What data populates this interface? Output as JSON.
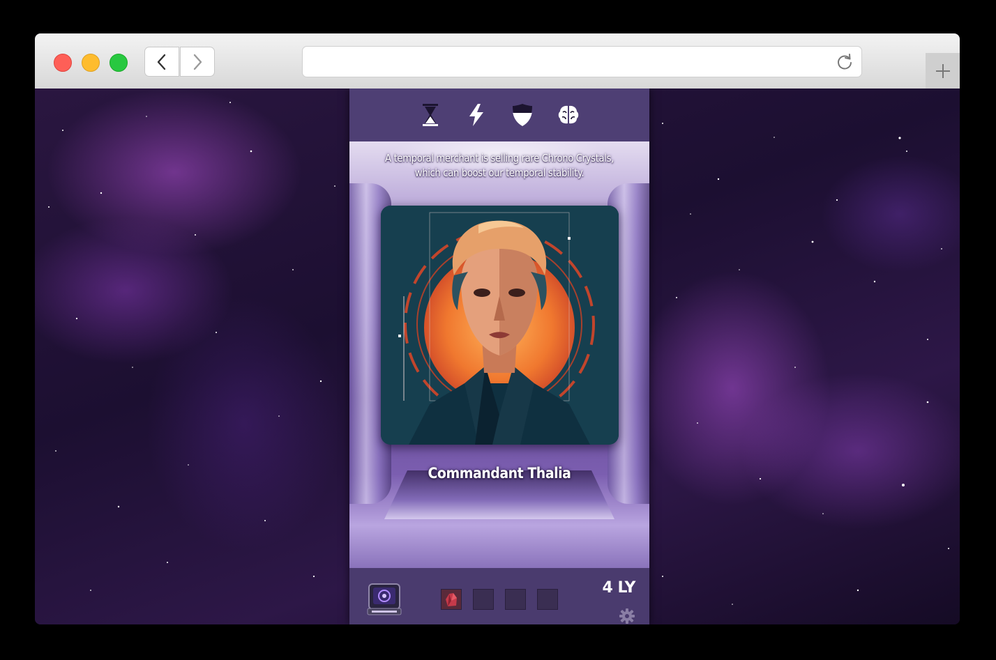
{
  "browser": {
    "url": "",
    "new_tab_label": "+"
  },
  "stats": [
    {
      "name": "time",
      "icon": "hourglass-icon"
    },
    {
      "name": "energy",
      "icon": "lightning-icon"
    },
    {
      "name": "defense",
      "icon": "shield-icon"
    },
    {
      "name": "intellect",
      "icon": "brain-icon"
    }
  ],
  "event": {
    "text": "A temporal merchant is selling rare Chrono Crystals, which can boost our temporal stability."
  },
  "character": {
    "name": "Commandant Thalia"
  },
  "footer": {
    "distance": "4 LY"
  },
  "colors": {
    "panel": "#4e3f74",
    "bottom_bar": "#4a3b6e",
    "text": "#ffffff"
  }
}
